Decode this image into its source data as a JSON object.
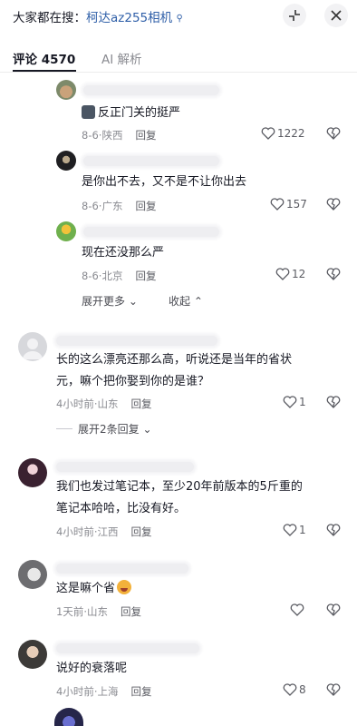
{
  "header": {
    "search_prefix": "大家都在搜：",
    "search_keyword": "柯达az255相机",
    "search_icon": "magnifier-icon",
    "mini_player_icon": "collapse-arrows-icon",
    "close_icon": "close-icon"
  },
  "tabs": [
    {
      "label": "评论 4570",
      "active": true
    },
    {
      "label": "AI 解析",
      "active": false
    }
  ],
  "replies": [
    {
      "text": "反正门关的挺严",
      "location": "8-6·陕西",
      "reply_label": "回复",
      "likes": "1222"
    },
    {
      "text": "是你出不去，又不是不让你出去",
      "location": "8-6·广东",
      "reply_label": "回复",
      "likes": "157"
    },
    {
      "text": "现在还没那么严",
      "location": "8-6·北京",
      "reply_label": "回复",
      "likes": "12"
    }
  ],
  "reply_controls": {
    "expand_more": "展开更多",
    "collapse": "收起"
  },
  "comments": [
    {
      "line1": "长的这么漂亮还那么高，听说还是当年的省状",
      "line2": "元，嘛个把你娶到你的是谁？",
      "location": "4小时前·山东",
      "reply_label": "回复",
      "likes": "1",
      "expand_label": "展开2条回复"
    },
    {
      "line1": "我们也发过笔记本，至少20年前版本的5斤重的",
      "line2": "笔记本哈哈，比没有好。",
      "location": "4小时前·江西",
      "reply_label": "回复",
      "likes": "1"
    },
    {
      "line1": "这是嘛个省",
      "location": "1天前·山东",
      "reply_label": "回复",
      "likes": ""
    },
    {
      "line1": "说好的衰落呢",
      "location": "4小时前·上海",
      "reply_label": "回复",
      "likes": "8"
    }
  ],
  "colors": {
    "link": "#2f5fa8",
    "meta": "#8a8b91",
    "text": "#161823"
  }
}
